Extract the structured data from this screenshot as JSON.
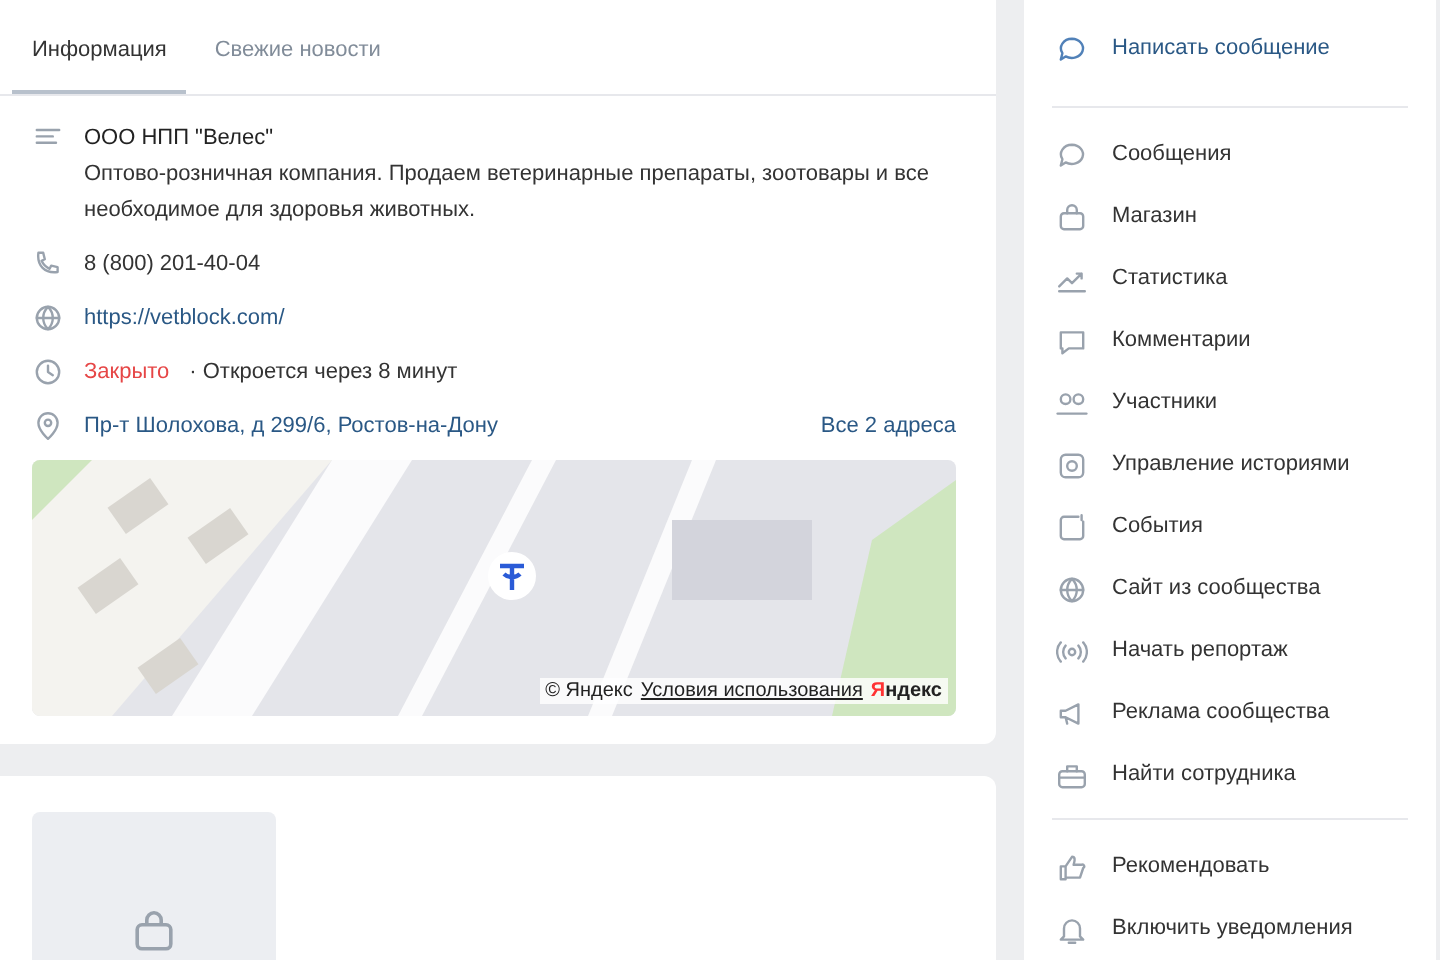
{
  "info_card": {
    "tabs": [
      {
        "label": "Информация",
        "selected": true
      },
      {
        "label": "Свежие новости",
        "selected": false
      }
    ],
    "rows": [
      {
        "kind": "description",
        "title": "ООО НПП \"Велес\"",
        "text": "Оптово-розничная компания. Продаем ветеринарные препараты, зоотовары и все необходимое для здоровья животных."
      },
      {
        "kind": "phone",
        "text": "8 (800) 201-40-04"
      },
      {
        "kind": "link",
        "text": "https://vetblock.com/"
      },
      {
        "kind": "hours",
        "status": "Закрыто",
        "open": false,
        "text": "· Откроется через 8 минут"
      },
      {
        "kind": "address",
        "text": "Пр-т Шолохова, д 299/6, Ростов-на-Дону",
        "extra": "Все 2 адреса"
      }
    ],
    "map": {
      "kind": "picture",
      "copyright": "© Яндекс",
      "terms": "Условия использования",
      "logo": "Яндекс"
    }
  },
  "sidebar": {
    "action": "Написать сообщение",
    "groups": [
      [
        "Сообщения",
        "Магазин",
        "Статистика",
        "Комментарии",
        "Участники",
        "Управление историями",
        "События",
        "Сайт из сообщества",
        "Начать репортаж",
        "Реклама сообщества",
        "Найти сотрудника"
      ],
      [
        "Рекомендовать",
        "Включить уведомления"
      ]
    ]
  }
}
